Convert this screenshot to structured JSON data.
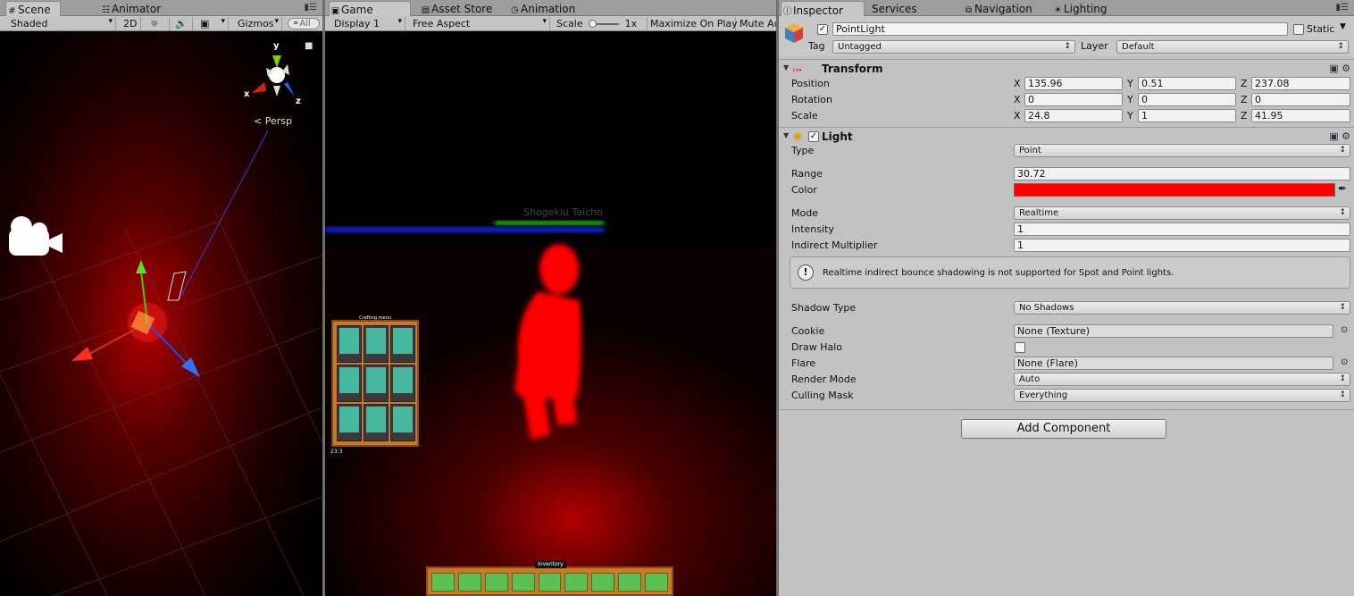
{
  "scene_panel": {
    "tabs": [
      {
        "icon": "grid-icon",
        "glyph": "#",
        "label": "Scene"
      },
      {
        "icon": "animator-icon",
        "glyph": "",
        "label": "Animator"
      }
    ],
    "toolbar": {
      "shading_mode": "Shaded",
      "mode_2d": "2D",
      "gizmos": "Gizmos",
      "search_placeholder": "All"
    },
    "gizmo": {
      "y": "y",
      "x": "x",
      "z": "z",
      "projection": "Persp"
    }
  },
  "game_panel": {
    "tabs": [
      {
        "icon": "game-icon",
        "glyph": "▣",
        "label": "Game"
      },
      {
        "icon": "store-icon",
        "glyph": "▤",
        "label": "Asset Store"
      },
      {
        "icon": "clock-icon",
        "glyph": "◷",
        "label": "Animation"
      }
    ],
    "toolbar": {
      "display": "Display 1",
      "aspect": "Free Aspect",
      "scale_label": "Scale",
      "scale_value": "1x",
      "maximize": "Maximize On Play",
      "mute": "Mute Au"
    },
    "hud": {
      "player_name": "Shogekiu Taicho",
      "crafting_title": "Crafting menu",
      "crafting_count": "23:3",
      "inventory_title": "Inventory"
    }
  },
  "inspector_panel": {
    "tabs": [
      {
        "icon": "info-icon",
        "glyph": "ⓘ",
        "label": "Inspector"
      },
      {
        "icon": "services-icon",
        "glyph": "",
        "label": "Services"
      },
      {
        "icon": "navigation-icon",
        "glyph": "⧉",
        "label": "Navigation"
      },
      {
        "icon": "lighting-icon",
        "glyph": "☀",
        "label": "Lighting"
      }
    ],
    "object": {
      "name": "PointLight",
      "static_label": "Static",
      "tag_label": "Tag",
      "tag_value": "Untagged",
      "layer_label": "Layer",
      "layer_value": "Default"
    },
    "transform": {
      "title": "Transform",
      "rows": [
        {
          "label": "Position",
          "x": "135.96",
          "y": "0.51",
          "z": "237.08"
        },
        {
          "label": "Rotation",
          "x": "0",
          "y": "0",
          "z": "0"
        },
        {
          "label": "Scale",
          "x": "24.8",
          "y": "1",
          "z": "41.95"
        }
      ],
      "axis_x": "X",
      "axis_y": "Y",
      "axis_z": "Z"
    },
    "light": {
      "title": "Light",
      "type_label": "Type",
      "type_value": "Point",
      "range_label": "Range",
      "range_value": "30.72",
      "color_label": "Color",
      "color_value": "#ff0000",
      "mode_label": "Mode",
      "mode_value": "Realtime",
      "intensity_label": "Intensity",
      "intensity_value": "1",
      "indirect_label": "Indirect Multiplier",
      "indirect_value": "1",
      "warning": "Realtime indirect bounce shadowing is not supported for Spot and Point lights.",
      "shadow_label": "Shadow Type",
      "shadow_value": "No Shadows",
      "cookie_label": "Cookie",
      "cookie_value": "None (Texture)",
      "halo_label": "Draw Halo",
      "flare_label": "Flare",
      "flare_value": "None (Flare)",
      "render_label": "Render Mode",
      "render_value": "Auto",
      "culling_label": "Culling Mask",
      "culling_value": "Everything"
    },
    "add_component": "Add Component"
  }
}
